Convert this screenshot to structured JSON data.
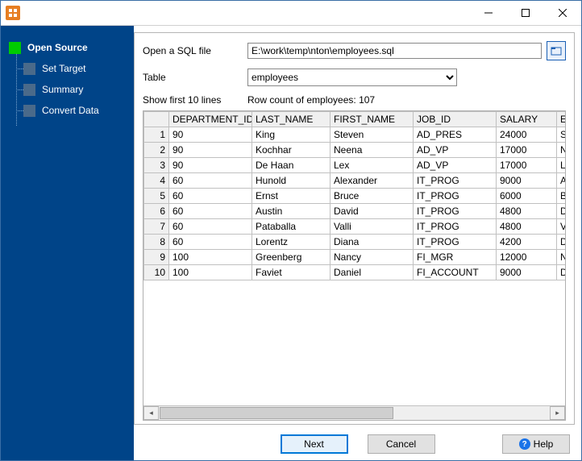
{
  "titlebar": {
    "title": ""
  },
  "sidebar": {
    "steps": [
      {
        "label": "Open Source"
      },
      {
        "label": "Set Target"
      },
      {
        "label": "Summary"
      },
      {
        "label": "Convert Data"
      }
    ]
  },
  "form": {
    "open_label": "Open a SQL file",
    "file_path": "E:\\work\\temp\\nton\\employees.sql",
    "table_label": "Table",
    "table_value": "employees",
    "show_first_label": "Show first 10 lines",
    "row_count_label": "Row count of employees: 107"
  },
  "grid": {
    "headers": [
      "DEPARTMENT_ID",
      "LAST_NAME",
      "FIRST_NAME",
      "JOB_ID",
      "SALARY",
      "EMAIL"
    ],
    "rows": [
      [
        "90",
        "King",
        "Steven",
        "AD_PRES",
        "24000",
        "SKING"
      ],
      [
        "90",
        "Kochhar",
        "Neena",
        "AD_VP",
        "17000",
        "NKOCHHAR"
      ],
      [
        "90",
        "De Haan",
        "Lex",
        "AD_VP",
        "17000",
        "LDEHAAN"
      ],
      [
        "60",
        "Hunold",
        "Alexander",
        "IT_PROG",
        "9000",
        "AHUNOLD"
      ],
      [
        "60",
        "Ernst",
        "Bruce",
        "IT_PROG",
        "6000",
        "BERNST"
      ],
      [
        "60",
        "Austin",
        "David",
        "IT_PROG",
        "4800",
        "DAUSTIN"
      ],
      [
        "60",
        "Pataballa",
        "Valli",
        "IT_PROG",
        "4800",
        "VPATABAL"
      ],
      [
        "60",
        "Lorentz",
        "Diana",
        "IT_PROG",
        "4200",
        "DLORENTZ"
      ],
      [
        "100",
        "Greenberg",
        "Nancy",
        "FI_MGR",
        "12000",
        "NGREENBE"
      ],
      [
        "100",
        "Faviet",
        "Daniel",
        "FI_ACCOUNT",
        "9000",
        "DFAVIET"
      ]
    ]
  },
  "footer": {
    "next": "Next",
    "cancel": "Cancel",
    "help": "Help"
  }
}
